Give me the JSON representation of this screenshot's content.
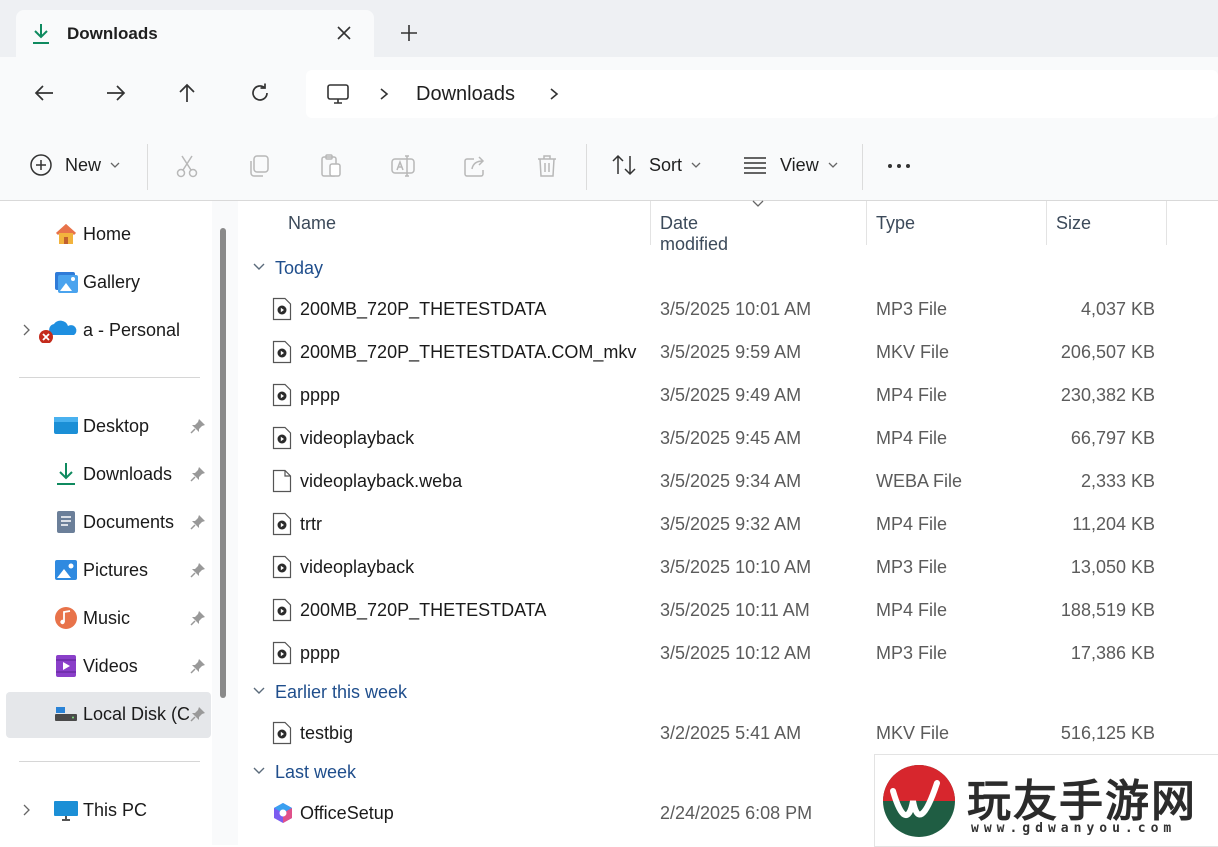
{
  "tab": {
    "title": "Downloads"
  },
  "breadcrumb": {
    "current": "Downloads"
  },
  "commandbar": {
    "new_label": "New",
    "sort_label": "Sort",
    "view_label": "View"
  },
  "nav": {
    "items": [
      {
        "label": "Home",
        "icon": "home-icon"
      },
      {
        "label": "Gallery",
        "icon": "gallery-icon"
      },
      {
        "label": "a - Personal",
        "icon": "onedrive-icon"
      },
      {
        "label": "Desktop",
        "icon": "desktop-icon"
      },
      {
        "label": "Downloads",
        "icon": "downloads-icon"
      },
      {
        "label": "Documents",
        "icon": "documents-icon"
      },
      {
        "label": "Pictures",
        "icon": "pictures-icon"
      },
      {
        "label": "Music",
        "icon": "music-icon"
      },
      {
        "label": "Videos",
        "icon": "videos-icon"
      },
      {
        "label": "Local Disk (C:",
        "icon": "drive-icon"
      },
      {
        "label": "This PC",
        "icon": "pc-icon"
      }
    ]
  },
  "columns": {
    "name": "Name",
    "date": "Date modified",
    "type": "Type",
    "size": "Size"
  },
  "groups": {
    "today": "Today",
    "earlier": "Earlier this week",
    "lastweek": "Last week"
  },
  "files": [
    {
      "name": "200MB_720P_THETESTDATA",
      "date": "3/5/2025 10:01 AM",
      "type": "MP3 File",
      "size": "4,037 KB"
    },
    {
      "name": "200MB_720P_THETESTDATA.COM_mkv",
      "date": "3/5/2025 9:59 AM",
      "type": "MKV File",
      "size": "206,507 KB"
    },
    {
      "name": "pppp",
      "date": "3/5/2025 9:49 AM",
      "type": "MP4 File",
      "size": "230,382 KB"
    },
    {
      "name": "videoplayback",
      "date": "3/5/2025 9:45 AM",
      "type": "MP4 File",
      "size": "66,797 KB"
    },
    {
      "name": "videoplayback.weba",
      "date": "3/5/2025 9:34 AM",
      "type": "WEBA File",
      "size": "2,333 KB"
    },
    {
      "name": "trtr",
      "date": "3/5/2025 9:32 AM",
      "type": "MP4 File",
      "size": "11,204 KB"
    },
    {
      "name": "videoplayback",
      "date": "3/5/2025 10:10 AM",
      "type": "MP3 File",
      "size": "13,050 KB"
    },
    {
      "name": "200MB_720P_THETESTDATA",
      "date": "3/5/2025 10:11 AM",
      "type": "MP4 File",
      "size": "188,519 KB"
    },
    {
      "name": "pppp",
      "date": "3/5/2025 10:12 AM",
      "type": "MP3 File",
      "size": "17,386 KB"
    },
    {
      "name": "testbig",
      "date": "3/2/2025 5:41 AM",
      "type": "MKV File",
      "size": "516,125 KB"
    },
    {
      "name": "OfficeSetup",
      "date": "2/24/2025 6:08 PM",
      "type": "",
      "size": ""
    }
  ],
  "watermark": {
    "brand_cn": "玩友手游网",
    "url": "www.gdwanyou.com"
  },
  "colors": {
    "accent": "#0067c0",
    "group_header": "#1f4e8c",
    "selected": "#e5e7ea"
  }
}
